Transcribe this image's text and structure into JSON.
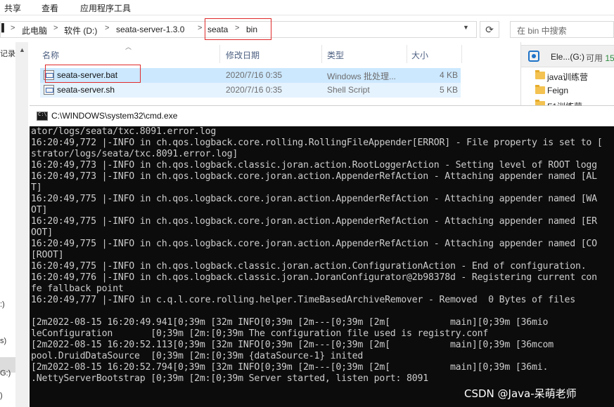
{
  "ribbon": {
    "tabs": [
      "共享",
      "查看",
      "应用程序工具"
    ]
  },
  "address": {
    "breadcrumbs": [
      "此电脑",
      "软件 (D:)",
      "seata-server-1.3.0",
      "seata",
      "bin"
    ],
    "separator": ">",
    "search_placeholder": "在 bin 中搜索"
  },
  "left_nav": {
    "labels": [
      "记录",
      ":)",
      "s)",
      "G:)",
      ")"
    ]
  },
  "columns": {
    "name": "名称",
    "modified": "修改日期",
    "type": "类型",
    "size": "大小"
  },
  "files": [
    {
      "name": "seata-server.bat",
      "modified": "2020/7/16 0:35",
      "type": "Windows 批处理...",
      "size": "4 KB",
      "selected": true
    },
    {
      "name": "seata-server.sh",
      "modified": "2020/7/16 0:35",
      "type": "Shell Script",
      "size": "5 KB",
      "selected": false
    }
  ],
  "right_pane": {
    "drive_name": "Ele...(G:)",
    "drive_free_label": "可用",
    "drive_free_value": "15",
    "folders": [
      "java训练营",
      "Feign",
      "F1训练营"
    ]
  },
  "cmd": {
    "title": "C:\\WINDOWS\\system32\\cmd.exe",
    "lines": [
      "ator/logs/seata/txc.8091.error.log",
      "16:20:49,772 |-INFO in ch.qos.logback.core.rolling.RollingFileAppender[ERROR] - File property is set to [",
      "strator/logs/seata/txc.8091.error.log]",
      "16:20:49,773 |-INFO in ch.qos.logback.classic.joran.action.RootLoggerAction - Setting level of ROOT logg",
      "16:20:49,773 |-INFO in ch.qos.logback.core.joran.action.AppenderRefAction - Attaching appender named [AL",
      "T]",
      "16:20:49,775 |-INFO in ch.qos.logback.core.joran.action.AppenderRefAction - Attaching appender named [WA",
      "OT]",
      "16:20:49,775 |-INFO in ch.qos.logback.core.joran.action.AppenderRefAction - Attaching appender named [ER",
      "OOT]",
      "16:20:49,775 |-INFO in ch.qos.logback.core.joran.action.AppenderRefAction - Attaching appender named [CO",
      "[ROOT]",
      "16:20:49,775 |-INFO in ch.qos.logback.classic.joran.action.ConfigurationAction - End of configuration.",
      "16:20:49,776 |-INFO in ch.qos.logback.classic.joran.JoranConfigurator@2b98378d - Registering current con",
      "fe fallback point",
      "16:20:49,777 |-INFO in c.q.l.core.rolling.helper.TimeBasedArchiveRemover - Removed  0 Bytes of files",
      "",
      "[2m2022-08-15 16:20:49.941[0;39m [32m INFO[0;39m [2m---[0;39m [2m[           main][0;39m [36mio",
      "leConfiguration       [0;39m [2m:[0;39m The configuration file used is registry.conf",
      "[2m2022-08-15 16:20:52.113[0;39m [32m INFO[0;39m [2m---[0;39m [2m[           main][0;39m [36mcom",
      "pool.DruidDataSource  [0;39m [2m:[0;39m {dataSource-1} inited",
      "[2m2022-08-15 16:20:52.794[0;39m [32m INFO[0;39m [2m---[0;39m [2m[           main][0;39m [36mi.",
      ".NettyServerBootstrap [0;39m [2m:[0;39m Server started, listen port: 8091"
    ]
  },
  "watermark": "CSDN @Java-呆萌老师",
  "colors": {
    "highlight_box": "#e02a2a",
    "selected_row": "#cce8ff",
    "console_bg": "#0c0c0c",
    "console_text": "#cccccc"
  }
}
